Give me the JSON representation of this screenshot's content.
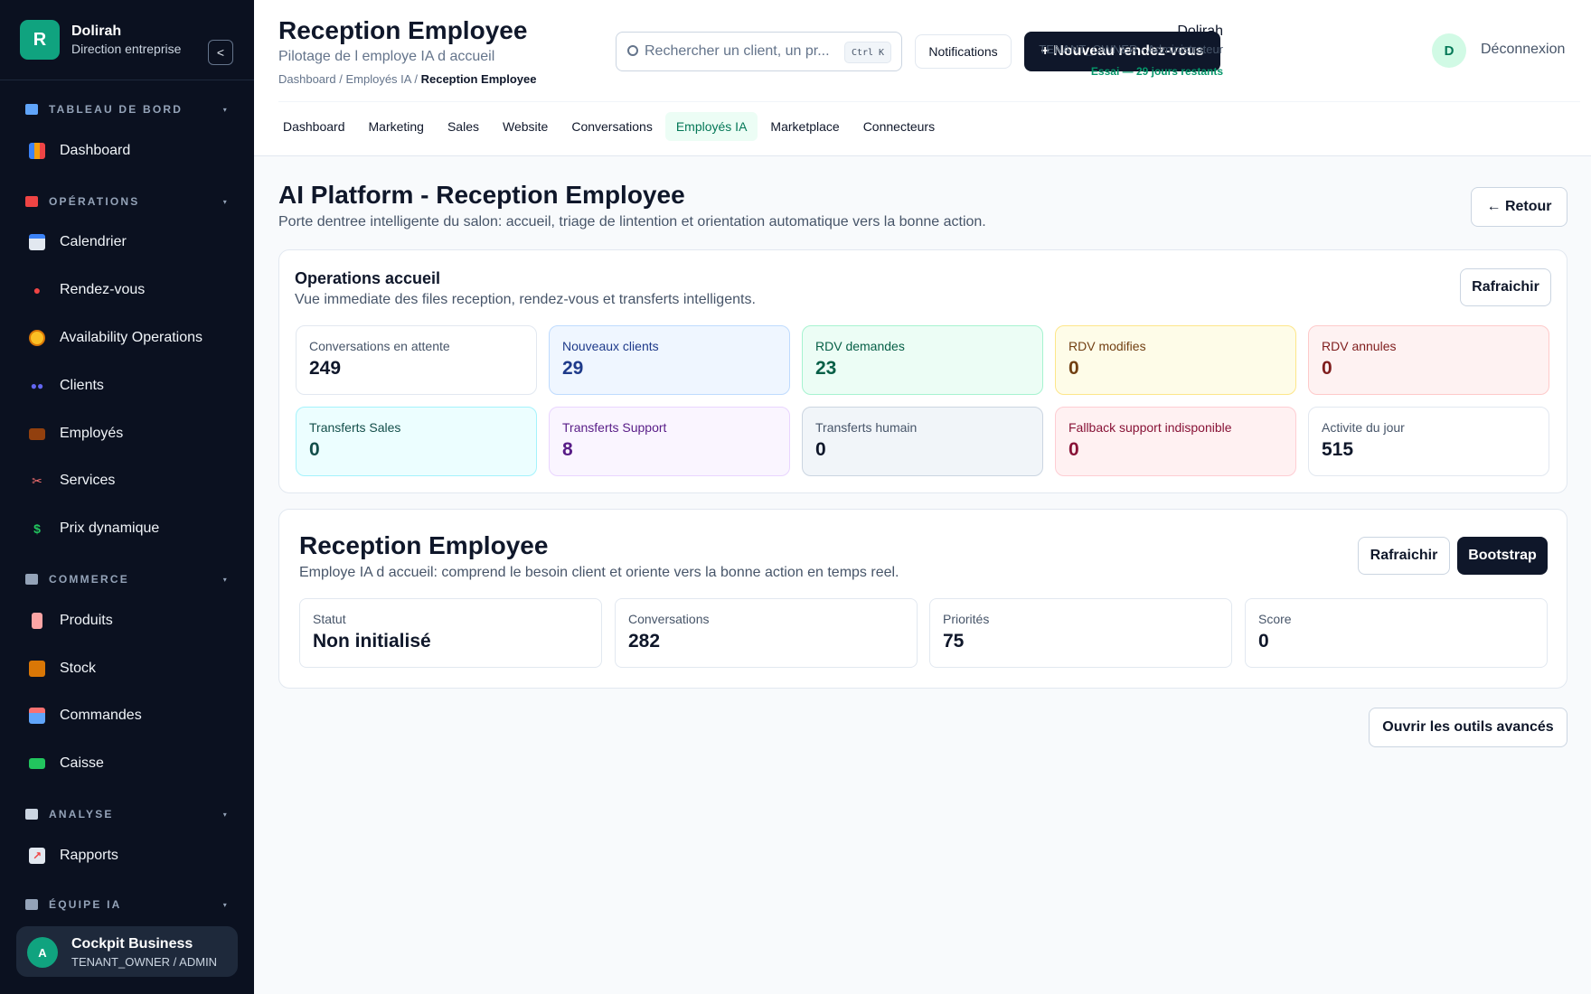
{
  "brand": {
    "logo_letter": "R",
    "name": "Dolirah",
    "subtitle": "Direction entreprise",
    "collapse_label": "<"
  },
  "sidebar": {
    "sections": [
      {
        "label": "TABLEAU DE BORD",
        "icon": "chart-icon",
        "items": [
          {
            "label": "Dashboard",
            "icon": "bar-chart-icon"
          }
        ]
      },
      {
        "label": "OPÉRATIONS",
        "icon": "toolbox-icon",
        "items": [
          {
            "label": "Calendrier",
            "icon": "calendar-icon"
          },
          {
            "label": "Rendez-vous",
            "icon": "pin-icon"
          },
          {
            "label": "Availability Operations",
            "icon": "clock-icon"
          },
          {
            "label": "Clients",
            "icon": "users-icon"
          },
          {
            "label": "Employés",
            "icon": "briefcase-icon"
          },
          {
            "label": "Services",
            "icon": "scissors-icon"
          },
          {
            "label": "Prix dynamique",
            "icon": "dollar-icon"
          }
        ]
      },
      {
        "label": "COMMERCE",
        "icon": "cart-icon",
        "items": [
          {
            "label": "Produits",
            "icon": "bottle-icon"
          },
          {
            "label": "Stock",
            "icon": "box-icon"
          },
          {
            "label": "Commandes",
            "icon": "mailbox-icon"
          },
          {
            "label": "Caisse",
            "icon": "cash-icon"
          }
        ]
      },
      {
        "label": "ANALYSE",
        "icon": "analysis-icon",
        "items": [
          {
            "label": "Rapports",
            "icon": "line-chart-icon"
          }
        ]
      },
      {
        "label": "ÉQUIPE IA",
        "icon": "robot-icon",
        "items": []
      }
    ],
    "footer": {
      "avatar_letter": "A",
      "name": "Cockpit Business",
      "role": "TENANT_OWNER / ADMIN"
    }
  },
  "header": {
    "title": "Reception Employee",
    "subtitle": "Pilotage de l employe IA d accueil",
    "breadcrumb": [
      "Dashboard",
      "Employés IA",
      "Reception Employee"
    ],
    "search_placeholder": "Rechercher un client, un pr...",
    "search_shortcut": "Ctrl K",
    "notifications_label": "Notifications",
    "new_appointment_label": "+ Nouveau rendez-vous",
    "user": {
      "name": "Dolirah",
      "role": "TENANT_OWNER · Administrateur",
      "trial": "Essai — 29 jours restants",
      "avatar_letter": "D"
    },
    "logout_label": "Déconnexion",
    "tabs": [
      "Dashboard",
      "Marketing",
      "Sales",
      "Website",
      "Conversations",
      "Employés IA",
      "Marketplace",
      "Connecteurs"
    ],
    "active_tab": "Employés IA"
  },
  "main": {
    "title": "AI Platform - Reception Employee",
    "description": "Porte dentree intelligente du salon: accueil, triage de lintention et orientation automatique vers la bonne action.",
    "back_label": "← Retour",
    "operations": {
      "title": "Operations accueil",
      "description": "Vue immediate des files reception, rendez-vous et transferts intelligents.",
      "refresh_label": "Rafraichir",
      "stats": [
        {
          "label": "Conversations en attente",
          "value": "249",
          "tone": "white"
        },
        {
          "label": "Nouveaux clients",
          "value": "29",
          "tone": "blue"
        },
        {
          "label": "RDV demandes",
          "value": "23",
          "tone": "green"
        },
        {
          "label": "RDV modifies",
          "value": "0",
          "tone": "yellow"
        },
        {
          "label": "RDV annules",
          "value": "0",
          "tone": "red"
        },
        {
          "label": "Transferts Sales",
          "value": "0",
          "tone": "cyan"
        },
        {
          "label": "Transferts Support",
          "value": "8",
          "tone": "purple"
        },
        {
          "label": "Transferts humain",
          "value": "0",
          "tone": "slate"
        },
        {
          "label": "Fallback support indisponible",
          "value": "0",
          "tone": "pink"
        },
        {
          "label": "Activite du jour",
          "value": "515",
          "tone": "white"
        }
      ]
    },
    "employee": {
      "title": "Reception Employee",
      "description": "Employe IA d accueil: comprend le besoin client et oriente vers la bonne action en temps reel.",
      "refresh_label": "Rafraichir",
      "bootstrap_label": "Bootstrap",
      "kpis": [
        {
          "label": "Statut",
          "value": "Non initialisé"
        },
        {
          "label": "Conversations",
          "value": "282"
        },
        {
          "label": "Priorités",
          "value": "75"
        },
        {
          "label": "Score",
          "value": "0"
        }
      ]
    },
    "advanced_label": "Ouvrir les outils avancés"
  }
}
